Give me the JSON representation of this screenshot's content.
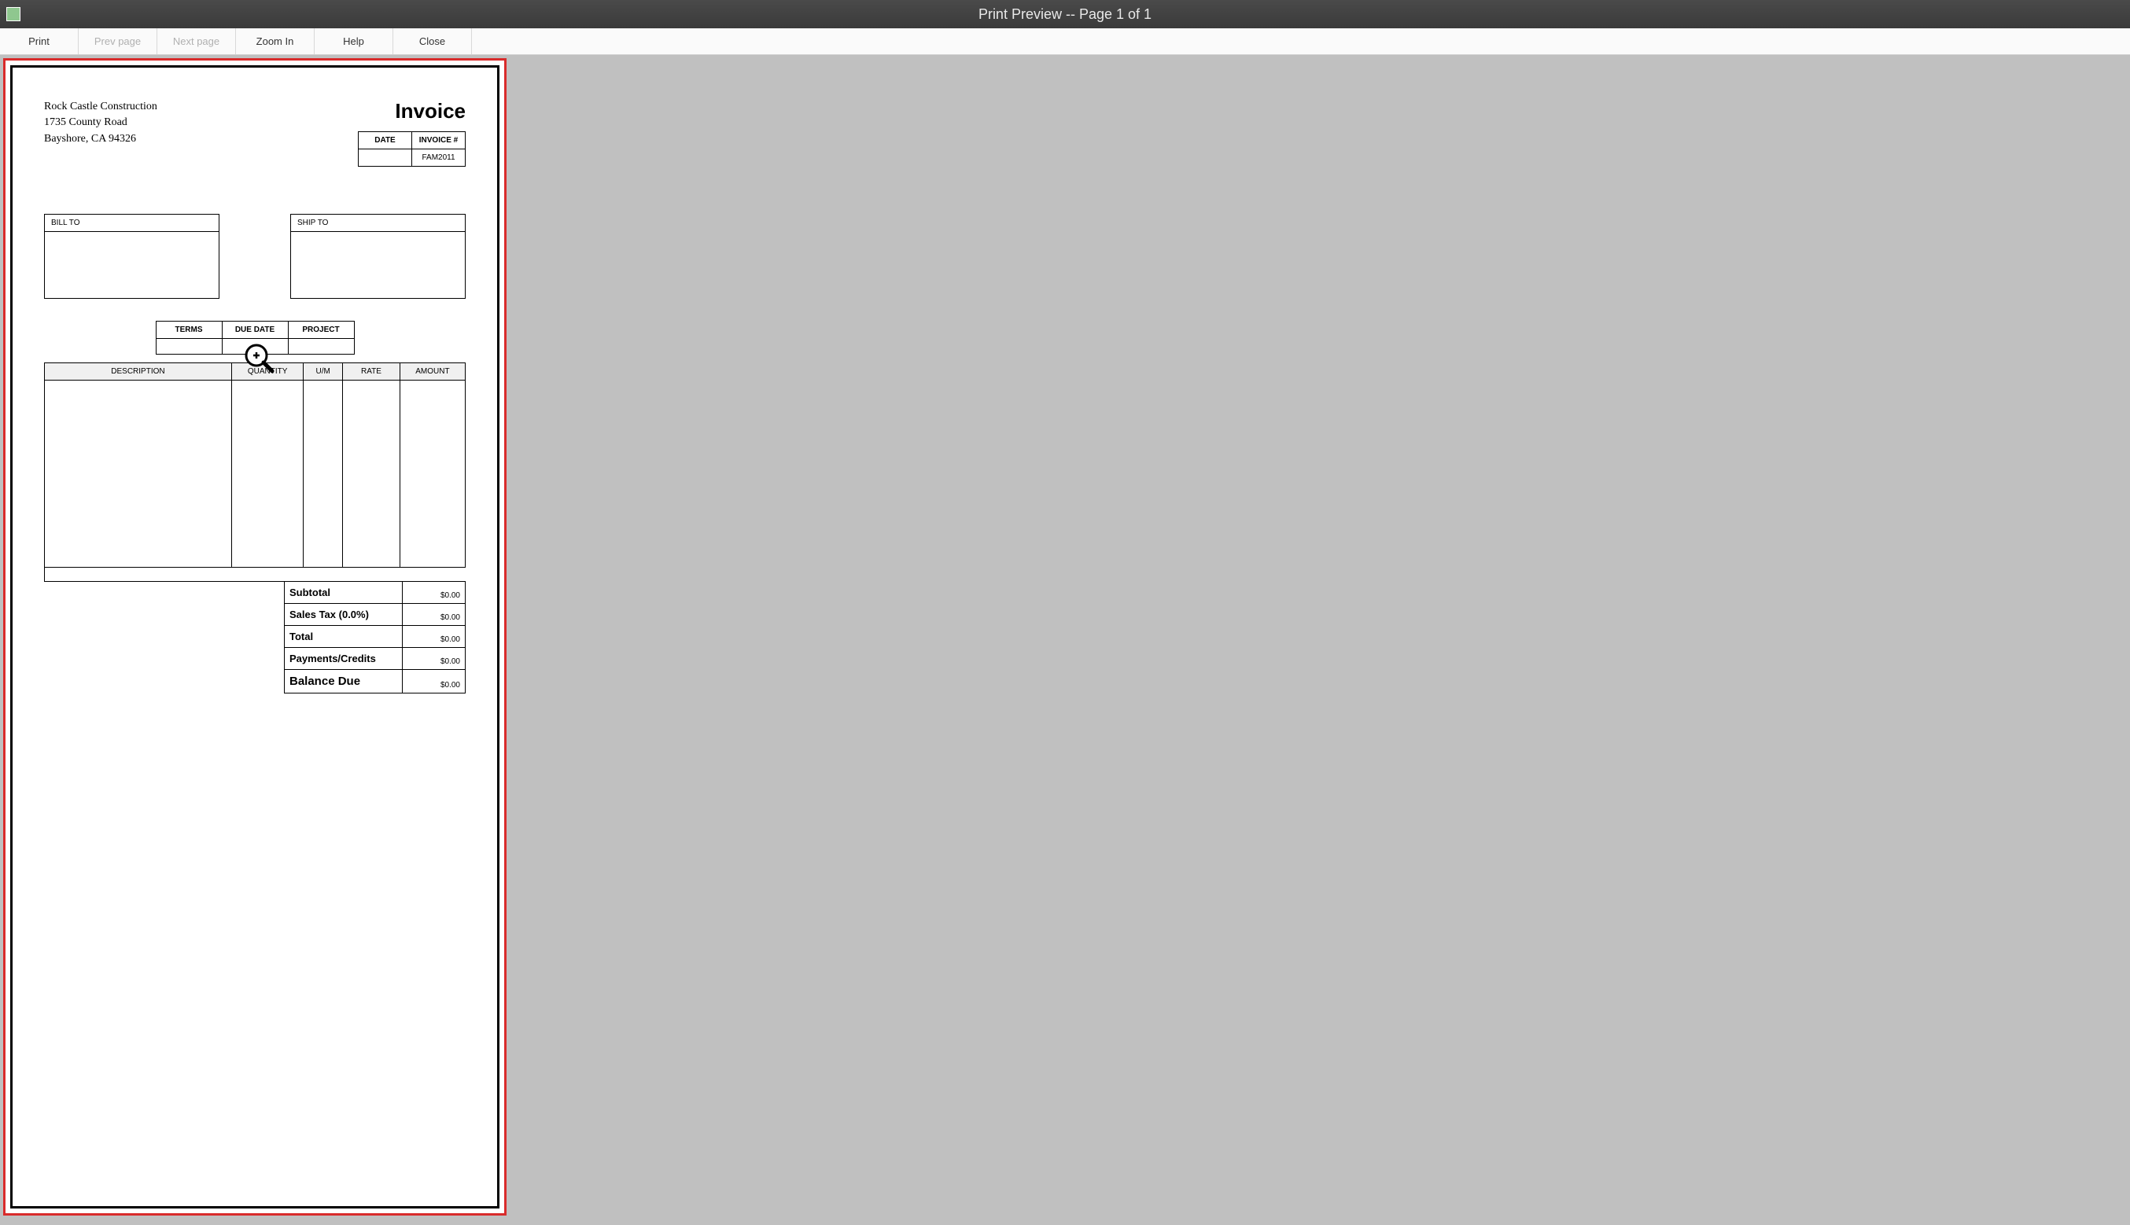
{
  "window": {
    "title": "Print Preview -- Page 1 of 1"
  },
  "toolbar": {
    "print": "Print",
    "prev": "Prev page",
    "next": "Next page",
    "zoom": "Zoom In",
    "help": "Help",
    "close": "Close"
  },
  "company": {
    "name": "Rock Castle Construction",
    "addr1": "1735 County Road",
    "addr2": "Bayshore, CA 94326"
  },
  "invoice": {
    "title": "Invoice",
    "meta": {
      "date_label": "DATE",
      "number_label": "INVOICE #",
      "date_value": "",
      "number_value": "FAM2011"
    }
  },
  "addresses": {
    "bill_to_label": "BILL TO",
    "ship_to_label": "SHIP TO"
  },
  "terms_headers": {
    "terms": "TERMS",
    "due_date": "DUE DATE",
    "project": "PROJECT"
  },
  "items_headers": {
    "description": "DESCRIPTION",
    "quantity": "QUANTITY",
    "um": "U/M",
    "rate": "RATE",
    "amount": "AMOUNT"
  },
  "totals": {
    "subtotal_label": "Subtotal",
    "subtotal_value": "$0.00",
    "tax_label": "Sales Tax  (0.0%)",
    "tax_value": "$0.00",
    "total_label": "Total",
    "total_value": "$0.00",
    "payments_label": "Payments/Credits",
    "payments_value": "$0.00",
    "balance_label": "Balance Due",
    "balance_value": "$0.00"
  }
}
